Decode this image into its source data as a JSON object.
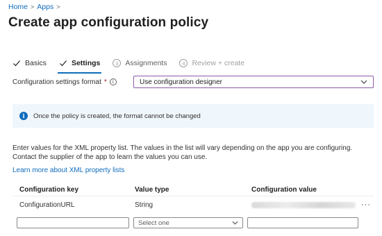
{
  "breadcrumb": {
    "home": "Home",
    "apps": "Apps",
    "sep": ">"
  },
  "page": {
    "title": "Create app configuration policy"
  },
  "steps": [
    {
      "num": "",
      "label": "Basics",
      "state": "done"
    },
    {
      "num": "",
      "label": "Settings",
      "state": "active"
    },
    {
      "num": "3",
      "label": "Assignments",
      "state": "pending"
    },
    {
      "num": "4",
      "label": "Review + create",
      "state": "disabled"
    }
  ],
  "format": {
    "label": "Configuration settings format",
    "required": "*",
    "info_icon": "i",
    "value": "Use configuration designer"
  },
  "banner": {
    "icon": "i",
    "text": "Once the policy is created, the format cannot be changed"
  },
  "description": "Enter values for the XML property list. The values in the list will vary depending on the app you are configuring. Contact the supplier of the app to learn the values you can use.",
  "learn_more": "Learn more about XML property lists",
  "table": {
    "headers": {
      "key": "Configuration key",
      "type": "Value type",
      "value": "Configuration value"
    },
    "rows": [
      {
        "key": "ConfigurationURL",
        "type": "String",
        "more": "···"
      }
    ],
    "new_row": {
      "type_placeholder": "Select one"
    }
  },
  "colors": {
    "accent": "#0f6cbd",
    "focus_border": "#8a5aa8",
    "banner_bg": "#eff6fc"
  }
}
